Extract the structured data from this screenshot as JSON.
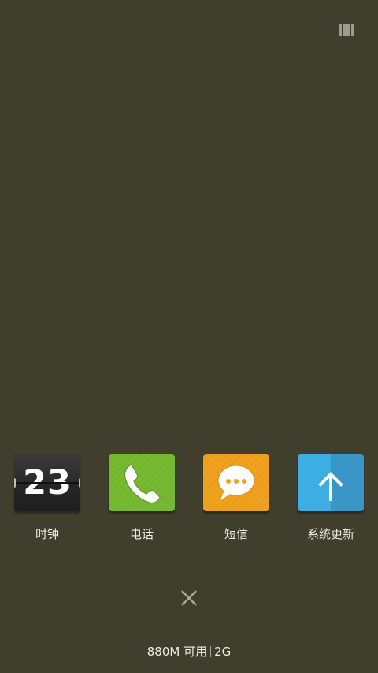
{
  "top_icon": "multi-window-icon",
  "apps": [
    {
      "name": "clock",
      "label": "时钟",
      "tile_text": "23",
      "icon": "flip-clock-icon",
      "color": "#2e2e2e"
    },
    {
      "name": "phone",
      "label": "电话",
      "icon": "phone-icon",
      "color": "#78b932"
    },
    {
      "name": "sms",
      "label": "短信",
      "icon": "message-bubble-icon",
      "color": "#efa21f"
    },
    {
      "name": "update",
      "label": "系统更新",
      "icon": "arrow-up-icon",
      "color": "#3daee3"
    }
  ],
  "close_icon": "close-icon",
  "memory": {
    "available": "880M 可用",
    "total": "2G"
  }
}
